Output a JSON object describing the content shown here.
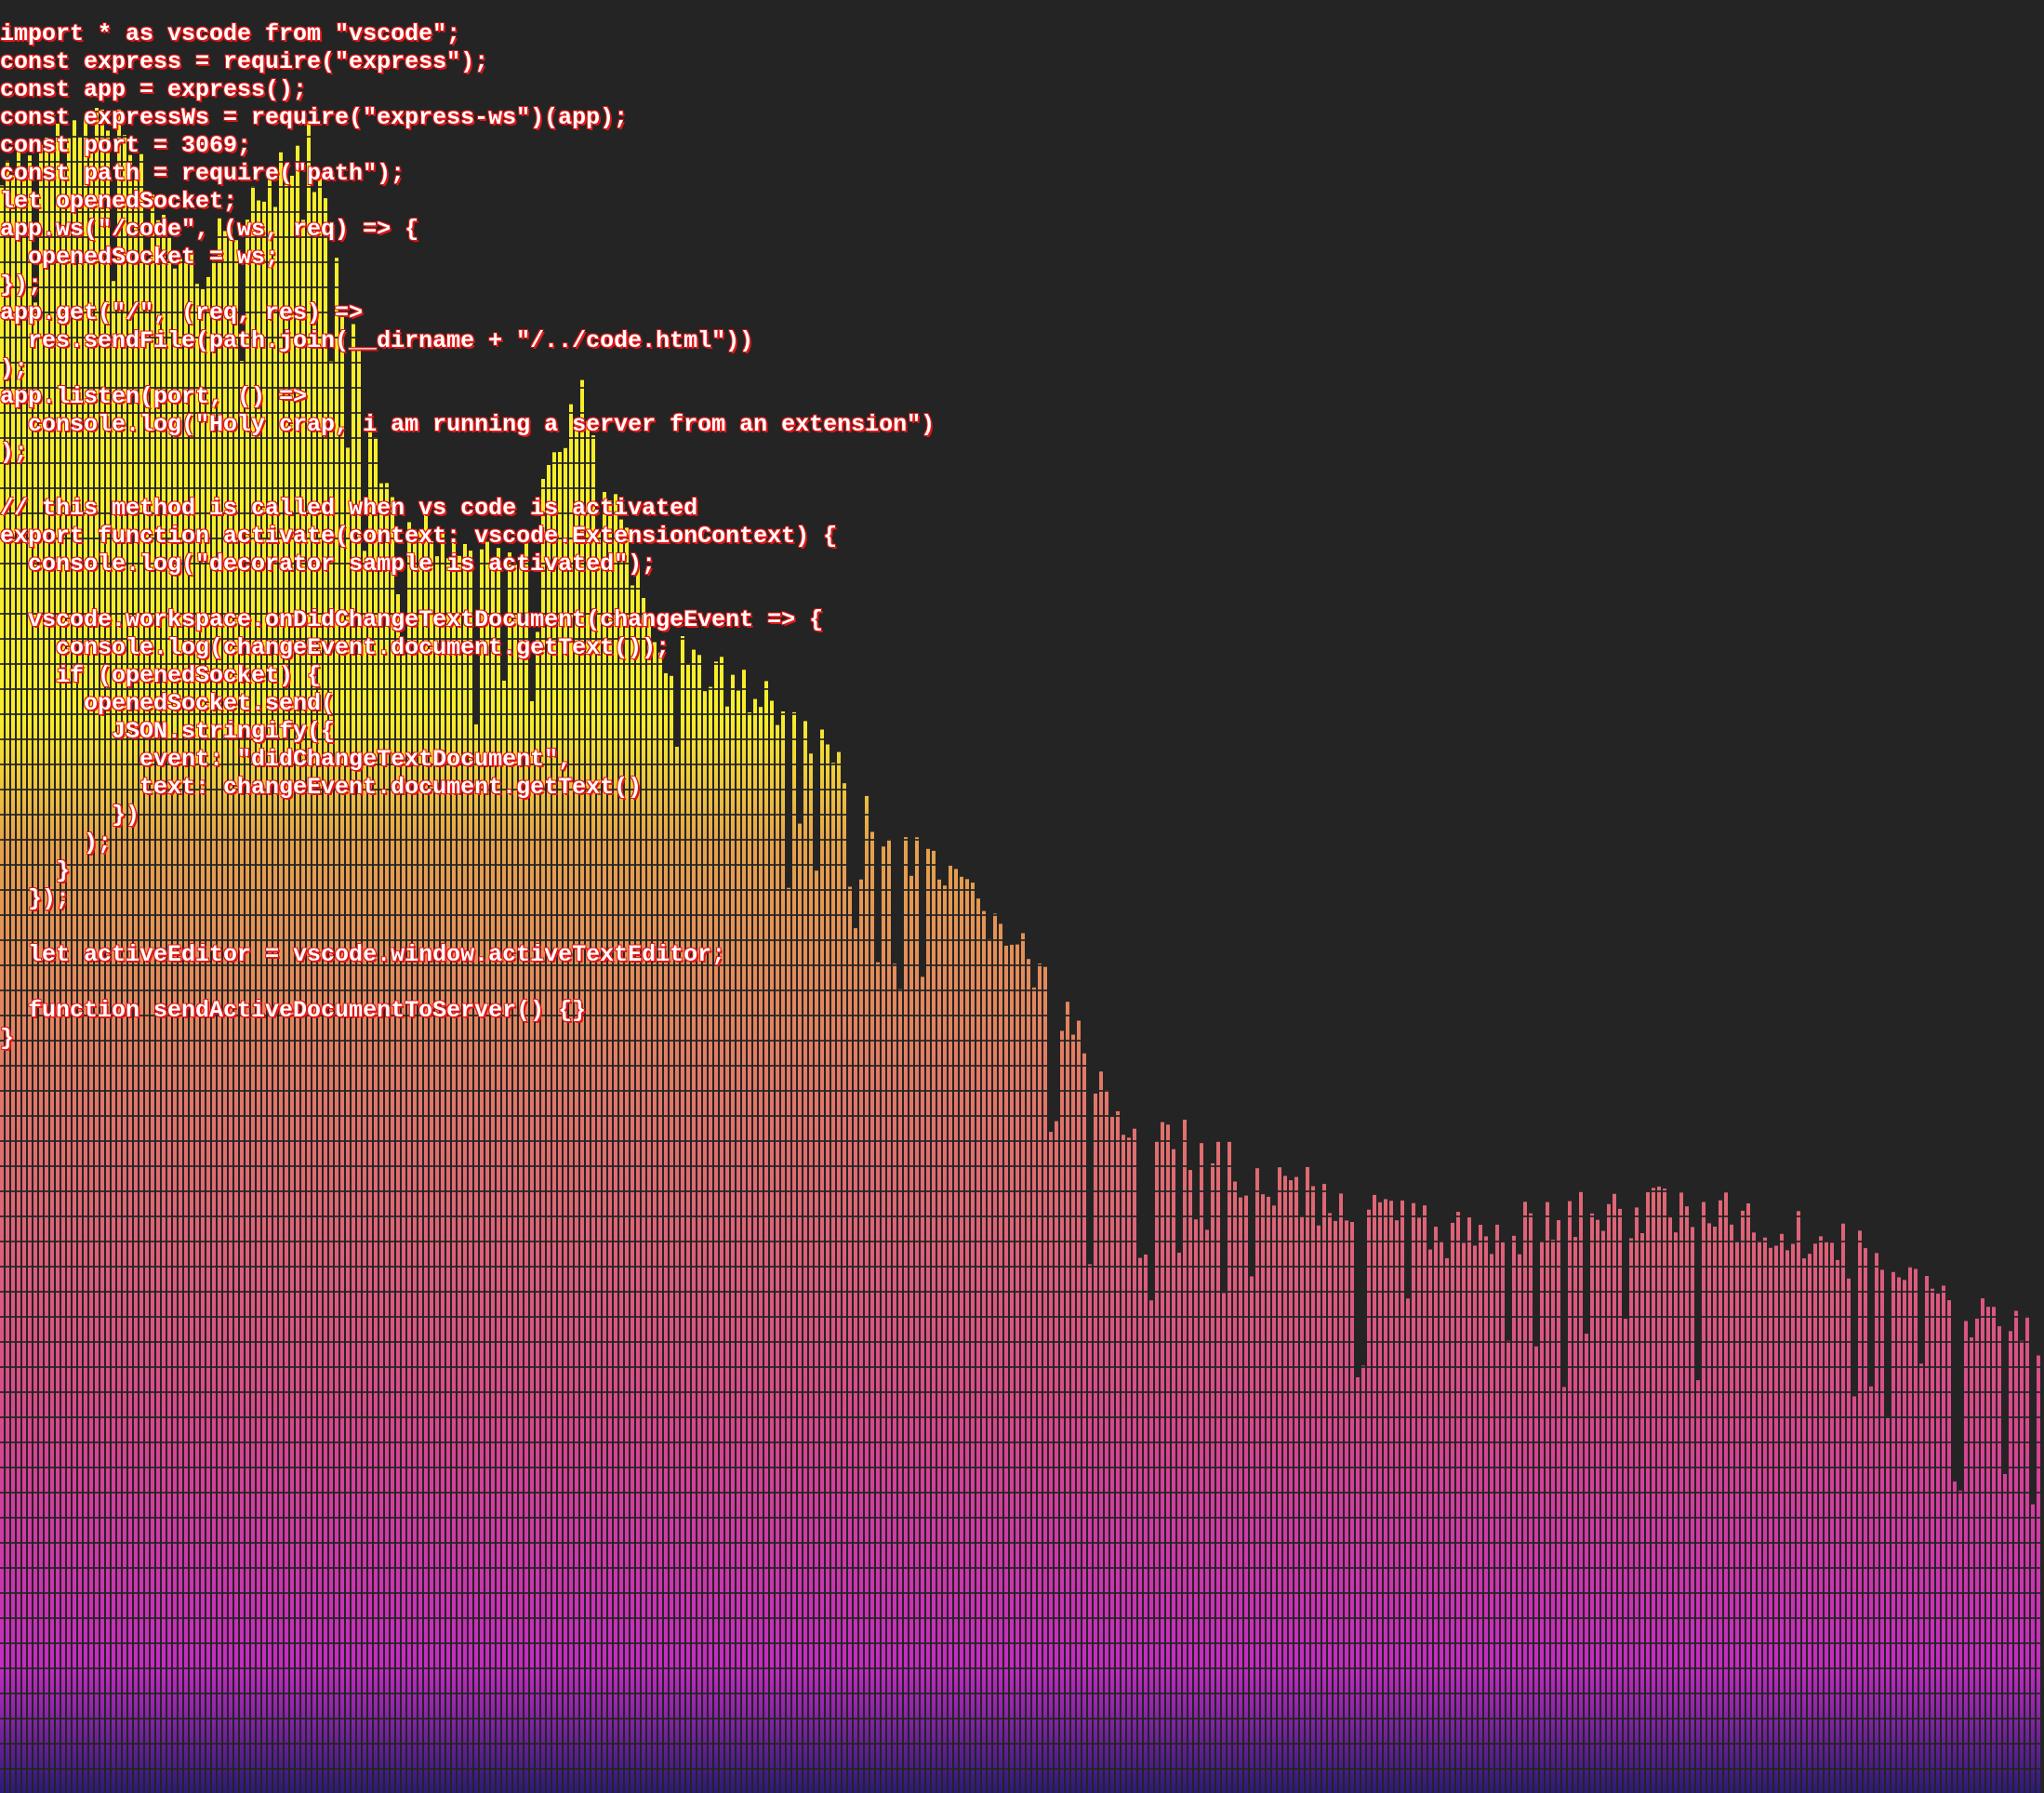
{
  "editor": {
    "lines": [
      "import * as vscode from \"vscode\";",
      "const express = require(\"express\");",
      "const app = express();",
      "const expressWs = require(\"express-ws\")(app);",
      "const port = 3069;",
      "const path = require(\"path\");",
      "let openedSocket;",
      "app.ws(\"/code\", (ws, req) => {",
      "  openedSocket = ws;",
      "});",
      "app.get(\"/\", (req, res) =>",
      "  res.sendFile(path.join(__dirname + \"/../code.html\"))",
      ");",
      "app.listen(port, () =>",
      "  console.log(\"Holy crap, i am running a server from an extension\")",
      ");",
      "",
      "// this method is called when vs code is activated",
      "export function activate(context: vscode.ExtensionContext) {",
      "  console.log(\"decorator sample is activated\");",
      "",
      "  vscode.workspace.onDidChangeTextDocument(changeEvent => {",
      "    console.log(changeEvent.document.getText());",
      "    if (openedSocket) {",
      "      openedSocket.send(",
      "        JSON.stringify({",
      "          event: \"didChangeTextDocument\",",
      "          text: changeEvent.document.getText()",
      "        })",
      "      );",
      "    }",
      "  });",
      "",
      "  let activeEditor = vscode.window.activeTextEditor;",
      "",
      "  function sendActiveDocumentToServer() {}",
      "}"
    ]
  },
  "visualizer": {
    "colors": {
      "background": "#242424",
      "top": "#f7ee2a",
      "mid_orange": "#e6a24a",
      "mid_salmon": "#e2746a",
      "lower_pink": "#d8468e",
      "bottom_magenta": "#c42bc2",
      "base_indigo": "#2a1a78",
      "code_text": "#ffffff",
      "code_shadow": "#e01818"
    }
  }
}
